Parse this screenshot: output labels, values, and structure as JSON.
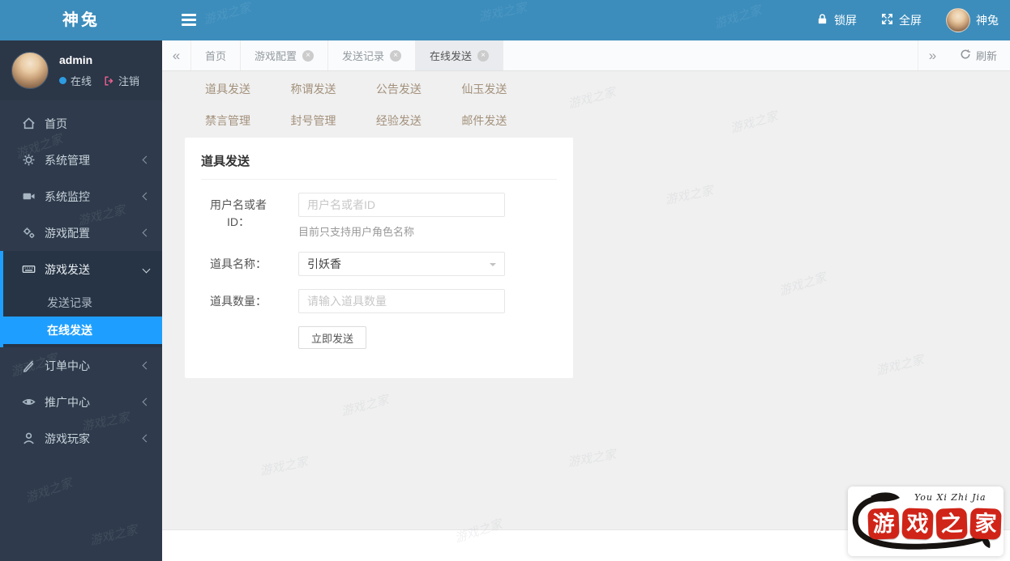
{
  "watermark": "游戏之家",
  "glyphs": {
    "close": "×",
    "nav_left": "«",
    "nav_right": "»"
  },
  "topbar": {
    "app_title": "神兔",
    "lock_label": "锁屏",
    "fullscreen_label": "全屏",
    "user_name": "神兔"
  },
  "sidebar": {
    "user": {
      "name": "admin",
      "status_online": "在线",
      "logout_label": "注销"
    },
    "items": [
      {
        "label": "首页"
      },
      {
        "label": "系统管理"
      },
      {
        "label": "系统监控"
      },
      {
        "label": "游戏配置"
      },
      {
        "label": "游戏发送",
        "children": [
          {
            "label": "发送记录"
          },
          {
            "label": "在线发送"
          }
        ]
      },
      {
        "label": "订单中心"
      },
      {
        "label": "推广中心"
      },
      {
        "label": "游戏玩家"
      }
    ]
  },
  "tabbar": {
    "tabs": [
      {
        "label": "首页"
      },
      {
        "label": "游戏配置"
      },
      {
        "label": "发送记录"
      },
      {
        "label": "在线发送"
      }
    ],
    "refresh_label": "刷新"
  },
  "subtabs": {
    "row1": [
      "道具发送",
      "称谓发送",
      "公告发送",
      "仙玉发送"
    ],
    "row2": [
      "禁言管理",
      "封号管理",
      "经验发送",
      "邮件发送"
    ]
  },
  "form": {
    "title": "道具发送",
    "username_label": "用户名或者ID：",
    "username_placeholder": "用户名或者ID",
    "username_hint": "目前只支持用户角色名称",
    "item_label": "道具名称：",
    "item_value": "引妖香",
    "qty_label": "道具数量：",
    "qty_placeholder": "请输入道具数量",
    "submit_label": "立即发送"
  },
  "logo_badge": {
    "pinyin": "You Xi Zhi Jia",
    "chars": [
      "游",
      "戏",
      "之",
      "家"
    ]
  },
  "colors": {
    "topbar_blue": "#3c8dbc",
    "sidebar_dark": "#2f3b4c",
    "active_blue": "#1e9fff",
    "seal_red": "#d02418",
    "subtab_text": "#a3917c"
  }
}
